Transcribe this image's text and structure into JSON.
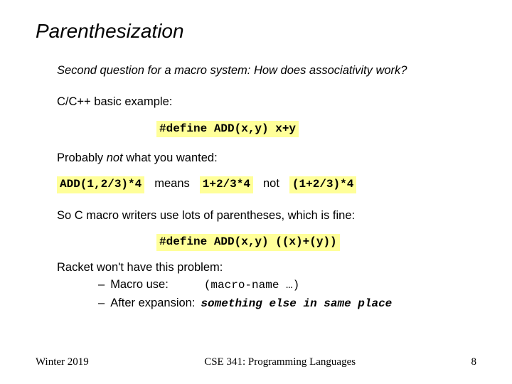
{
  "title": "Parenthesization",
  "intro": "Second question for a macro system: How does associativity work?",
  "example_label": "C/C++ basic example:",
  "define1": "#define ADD(x,y) x+y",
  "probably_prefix": "Probably ",
  "probably_not": "not",
  "probably_suffix": " what you wanted:",
  "expr_call": "ADD(1,2/3)*4",
  "means": "means",
  "expr_means": "1+2/3*4",
  "not": "not",
  "expr_not": "(1+2/3)*4",
  "so_line": "So C macro writers use lots of parentheses, which is fine:",
  "define2": "#define ADD(x,y) ((x)+(y))",
  "racket_line": "Racket won't have this problem:",
  "bullet1_label": "Macro use:",
  "bullet1_code": "(macro-name …)",
  "bullet2_label": "After expansion:",
  "bullet2_code": "something else in same place",
  "footer": {
    "term": "Winter 2019",
    "course": "CSE 341: Programming Languages",
    "page": "8"
  }
}
